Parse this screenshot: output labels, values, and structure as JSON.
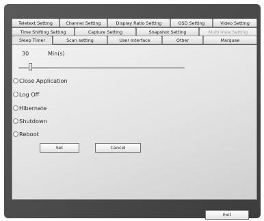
{
  "tabs": {
    "row1": [
      {
        "label": "Teletext Setting"
      },
      {
        "label": "Channel Setting"
      },
      {
        "label": "Display Ratio Setting"
      },
      {
        "label": "OSD Setting"
      },
      {
        "label": "Video Setting"
      }
    ],
    "row2": [
      {
        "label": "Time Shifting Setting"
      },
      {
        "label": "Capture Setting"
      },
      {
        "label": "Snapshot Setting"
      },
      {
        "label": "Multi View Setting"
      }
    ],
    "row3": [
      {
        "label": "Sleep Timer"
      },
      {
        "label": "Scan setting"
      },
      {
        "label": "User Interface"
      },
      {
        "label": "Other"
      },
      {
        "label": "Marquee"
      }
    ]
  },
  "sleep_timer": {
    "value": "30",
    "unit": "Min(s)",
    "slider_fraction": 0.06
  },
  "options": [
    {
      "label": "Close Application"
    },
    {
      "label": "Log Off"
    },
    {
      "label": "Hibernate"
    },
    {
      "label": "Shutdown"
    },
    {
      "label": "Reboot"
    }
  ],
  "buttons": {
    "set": "Set",
    "cancel": "Cancel",
    "exit": "Exit"
  }
}
